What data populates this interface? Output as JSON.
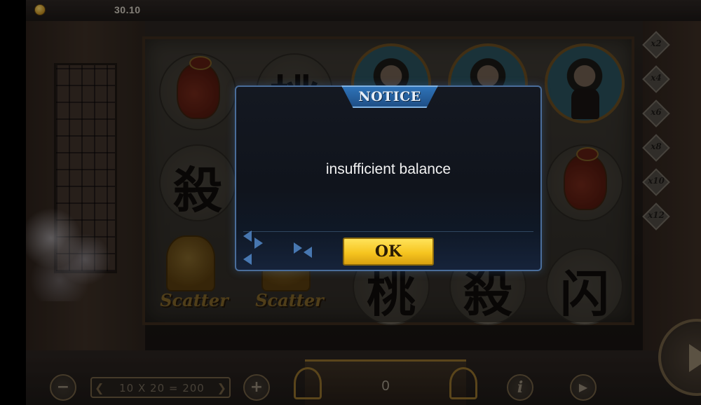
{
  "topbar": {
    "balance": "30.10",
    "coin_icon": "coin-icon"
  },
  "reels": {
    "row1": [
      {
        "type": "bag",
        "icon": "money-bag-icon"
      },
      {
        "type": "char",
        "text": "桃"
      },
      {
        "type": "portrait",
        "icon": "warrior-portrait-icon"
      },
      {
        "type": "portrait",
        "icon": "warrior-portrait-icon"
      },
      {
        "type": "portrait",
        "icon": "warrior-portrait-icon"
      }
    ],
    "row2": [
      {
        "type": "char",
        "text": "殺"
      },
      {
        "type": "char",
        "text": ""
      },
      {
        "type": "char",
        "text": ""
      },
      {
        "type": "char",
        "text": ""
      },
      {
        "type": "bag",
        "icon": "money-bag-icon"
      }
    ],
    "row3": [
      {
        "type": "scatter",
        "label": "Scatter"
      },
      {
        "type": "scatter",
        "label": "Scatter"
      },
      {
        "type": "char",
        "text": "桃"
      },
      {
        "type": "char",
        "text": "殺"
      },
      {
        "type": "char",
        "text": "闪"
      }
    ]
  },
  "multipliers": [
    "x2",
    "x4",
    "x6",
    "x8",
    "x10",
    "x12"
  ],
  "bottom": {
    "bet_text": "10 X 20 = 200",
    "win_value": "0",
    "minus_label": "−",
    "plus_label": "+",
    "info_label": "i",
    "autoplay_label": "▶"
  },
  "modal": {
    "title": "NOTICE",
    "message": "insufficient balance",
    "ok_label": "OK"
  }
}
